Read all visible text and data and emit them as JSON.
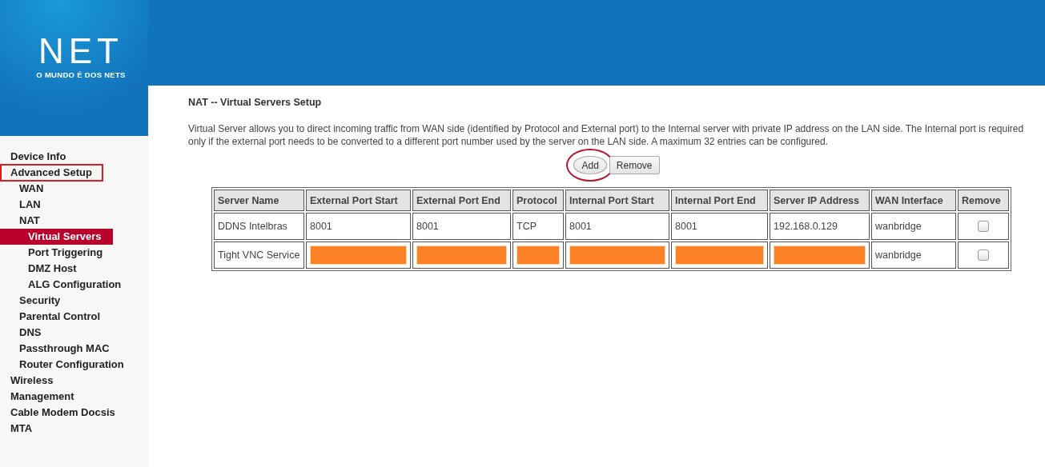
{
  "logo": {
    "name": "NET",
    "tagline": "O MUNDO É DOS NETS"
  },
  "sidebar": {
    "items": [
      {
        "label": "Device Info",
        "selected": false,
        "highlighted": false
      },
      {
        "label": "Advanced Setup",
        "selected": false,
        "highlighted": true,
        "children": [
          {
            "label": "WAN",
            "selected": false
          },
          {
            "label": "LAN",
            "selected": false
          },
          {
            "label": "NAT",
            "selected": false,
            "children": [
              {
                "label": "Virtual Servers",
                "selected": true
              },
              {
                "label": "Port Triggering",
                "selected": false
              },
              {
                "label": "DMZ Host",
                "selected": false
              },
              {
                "label": "ALG Configuration",
                "selected": false
              }
            ]
          },
          {
            "label": "Security",
            "selected": false
          },
          {
            "label": "Parental Control",
            "selected": false
          },
          {
            "label": "DNS",
            "selected": false
          },
          {
            "label": "Passthrough MAC",
            "selected": false
          },
          {
            "label": "Router Configuration",
            "selected": false
          }
        ]
      },
      {
        "label": "Wireless",
        "selected": false,
        "highlighted": false
      },
      {
        "label": "Management",
        "selected": false,
        "highlighted": false
      },
      {
        "label": "Cable Modem Docsis",
        "selected": false,
        "highlighted": false
      },
      {
        "label": "MTA",
        "selected": false,
        "highlighted": false
      }
    ]
  },
  "page": {
    "title": "NAT -- Virtual Servers Setup",
    "description": "Virtual Server allows you to direct incoming traffic from WAN side (identified by Protocol and External port) to the Internal server with private IP address on the LAN side. The Internal port is required only if the external port needs to be converted to a different port number used by the server on the LAN side. A maximum 32 entries can be configured.",
    "buttons": [
      {
        "label": "Add",
        "circled": true
      },
      {
        "label": "Remove",
        "circled": false
      }
    ]
  },
  "table": {
    "columns": [
      "Server Name",
      "External Port Start",
      "External Port End",
      "Protocol",
      "Internal Port Start",
      "Internal Port End",
      "Server IP Address",
      "WAN Interface",
      "Remove"
    ],
    "rows": [
      {
        "cells": [
          {
            "kind": "text",
            "text": "DDNS Intelbras"
          },
          {
            "kind": "text",
            "text": "8001"
          },
          {
            "kind": "text",
            "text": "8001"
          },
          {
            "kind": "text",
            "text": "TCP"
          },
          {
            "kind": "text",
            "text": "8001"
          },
          {
            "kind": "text",
            "text": "8001"
          },
          {
            "kind": "text",
            "text": "192.168.0.129"
          },
          {
            "kind": "text",
            "text": "wanbridge"
          }
        ],
        "checked": false
      },
      {
        "cells": [
          {
            "kind": "text",
            "text": "Tight VNC Service"
          },
          {
            "kind": "redacted"
          },
          {
            "kind": "redacted"
          },
          {
            "kind": "redacted"
          },
          {
            "kind": "redacted"
          },
          {
            "kind": "redacted"
          },
          {
            "kind": "redacted"
          },
          {
            "kind": "text",
            "text": "wanbridge"
          }
        ],
        "checked": false
      }
    ]
  }
}
